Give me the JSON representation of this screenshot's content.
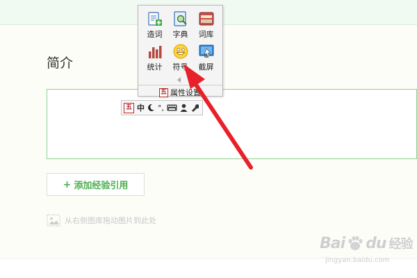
{
  "section": {
    "title": "简介"
  },
  "add_reference": {
    "plus": "+",
    "label": "添加经验引用"
  },
  "drag_hint": {
    "text": "从右侧图库拖动图片到此处"
  },
  "ime_panel": {
    "items": [
      {
        "label": "造词",
        "icon": "create-word-icon"
      },
      {
        "label": "字典",
        "icon": "dictionary-icon"
      },
      {
        "label": "词库",
        "icon": "word-library-icon"
      },
      {
        "label": "统计",
        "icon": "statistics-icon"
      },
      {
        "label": "符号",
        "icon": "smiley-symbol-icon"
      },
      {
        "label": "截屏",
        "icon": "screenshot-icon"
      }
    ],
    "settings": {
      "logo": "五",
      "label": "属性设置"
    }
  },
  "ime_toolbar": {
    "logo": "五",
    "mode": "中",
    "width_icon": "moon-icon",
    "punct": "°,",
    "keyboard_icon": "keyboard-icon",
    "user_icon": "user-icon",
    "tools_icon": "wrench-icon"
  },
  "watermark": {
    "brand": "Bai",
    "brand_tail": "du",
    "cn": "经验",
    "url": "jingyan.baidu.com"
  },
  "colors": {
    "accent_green": "#4caf50",
    "editor_border": "#8ecf8e",
    "arrow_red": "#e8202a"
  }
}
